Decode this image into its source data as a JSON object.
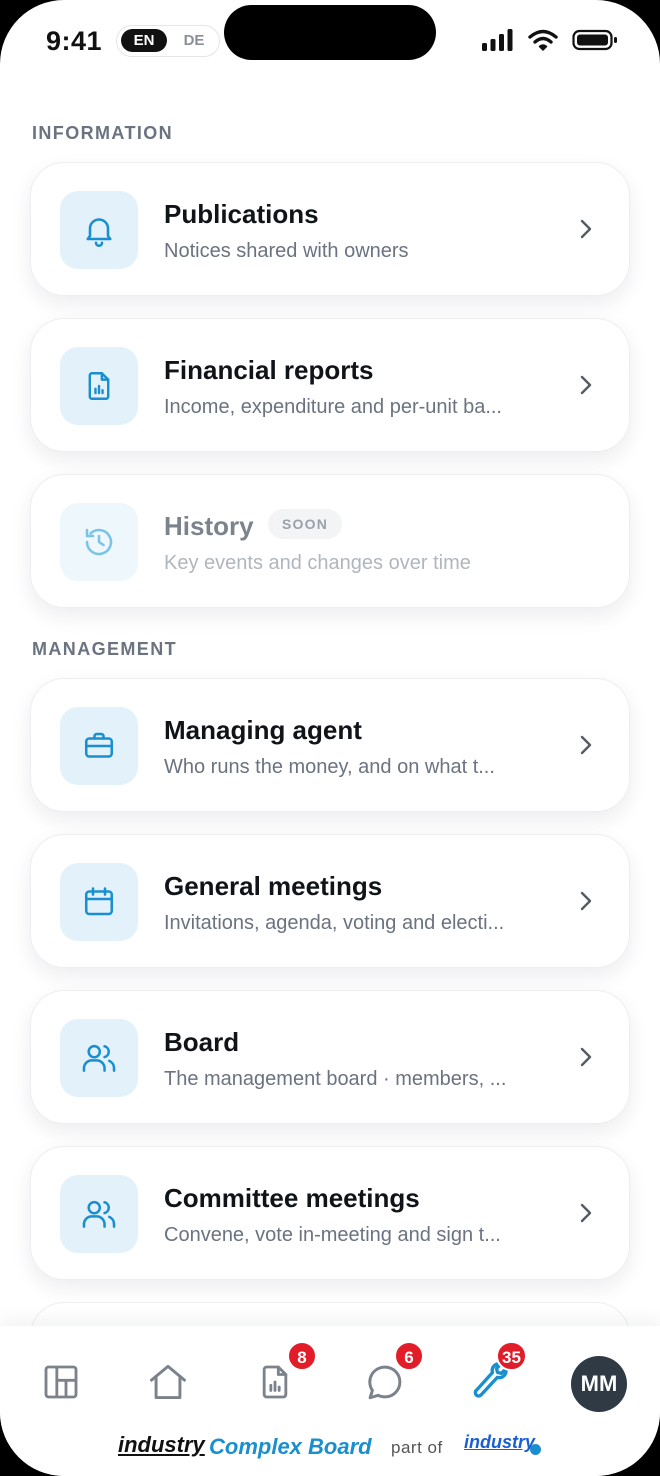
{
  "status_bar": {
    "time": "9:41",
    "lang_active": "EN",
    "lang_inactive": "DE"
  },
  "sections": {
    "information": "INFORMATION",
    "management": "MANAGEMENT"
  },
  "items": [
    {
      "title": "Publications",
      "subtitle": "Notices shared with owners",
      "icon": "bell-icon"
    },
    {
      "title": "Financial reports",
      "subtitle": "Income, expenditure and per-unit ba...",
      "icon": "report-icon"
    },
    {
      "title": "History",
      "subtitle": "Key events and changes over time",
      "icon": "history-icon",
      "badge": "SOON"
    },
    {
      "title": "Managing agent",
      "subtitle": "Who runs the money, and on what t...",
      "icon": "briefcase-icon"
    },
    {
      "title": "General meetings",
      "subtitle": "Invitations, agenda, voting and electi...",
      "icon": "calendar-icon"
    },
    {
      "title": "Board",
      "subtitle": "The management board · members, ...",
      "icon": "users-icon"
    },
    {
      "title": "Committee meetings",
      "subtitle": "Convene, vote in-meeting and sign t...",
      "icon": "users-icon"
    }
  ],
  "bottom_nav": {
    "items": [
      {
        "name": "dashboard-icon"
      },
      {
        "name": "home-icon"
      },
      {
        "name": "reports-icon",
        "badge": "8"
      },
      {
        "name": "chat-icon",
        "badge": "6"
      },
      {
        "name": "wrench-icon",
        "badge": "35"
      }
    ],
    "avatar": "MM"
  },
  "footer": {
    "brand_primary": "industry",
    "brand_secondary": "Complex Board",
    "part_of": "part of",
    "brand_parent": "industry"
  },
  "colors": {
    "accent": "#1a8fd0",
    "icon_bg": "#e2f1fa",
    "badge": "#e11d2a"
  }
}
